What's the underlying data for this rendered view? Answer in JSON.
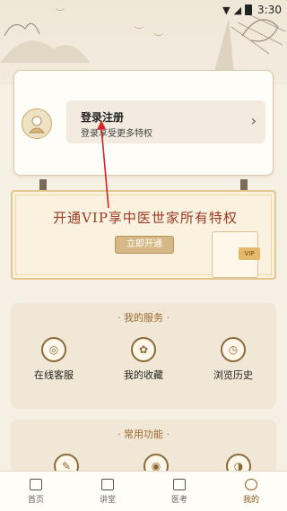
{
  "status_bar": {
    "time": "3:30"
  },
  "profile": {
    "login_title": "登录注册",
    "login_subtitle": "登录享受更多特权",
    "chevron": "›"
  },
  "vip": {
    "title": "开通VIP享中医世家所有特权",
    "button_label": "立即开通",
    "tag": "VIP"
  },
  "services": {
    "title": "我的服务",
    "items": [
      {
        "label": "在线客服",
        "icon": "customer-service-icon"
      },
      {
        "label": "我的收藏",
        "icon": "favorites-icon"
      },
      {
        "label": "浏览历史",
        "icon": "history-icon"
      }
    ]
  },
  "common": {
    "title": "常用功能"
  },
  "tabs": [
    {
      "label": "首页",
      "icon": "home-icon",
      "active": false
    },
    {
      "label": "讲堂",
      "icon": "lecture-icon",
      "active": false
    },
    {
      "label": "医考",
      "icon": "exam-icon",
      "active": false
    },
    {
      "label": "我的",
      "icon": "profile-icon",
      "active": true
    }
  ],
  "colors": {
    "background": "#f6efe3",
    "accent": "#9a3a24",
    "gold": "#d6b887",
    "annotation_arrow": "#d3252a"
  }
}
